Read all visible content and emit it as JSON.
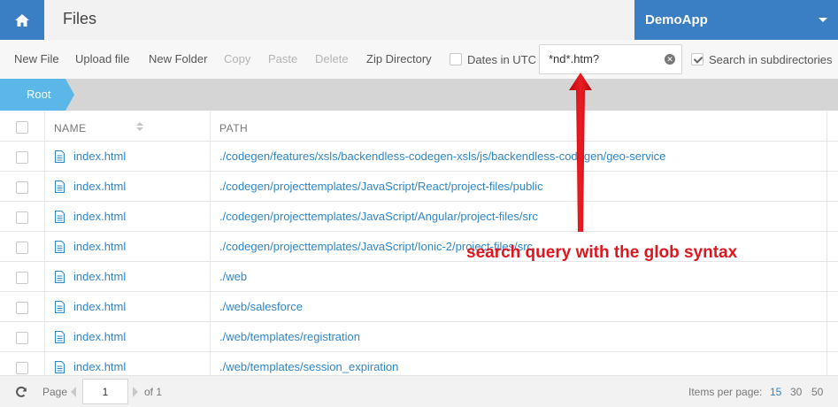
{
  "header": {
    "title": "Files",
    "app_name": "DemoApp"
  },
  "toolbar": {
    "new_file": "New File",
    "upload_file": "Upload file",
    "new_folder": "New Folder",
    "copy": "Copy",
    "paste": "Paste",
    "delete": "Delete",
    "zip_directory": "Zip Directory",
    "dates_utc_label": "Dates in UTC",
    "dates_utc_checked": false,
    "search_value": "*nd*.htm?",
    "search_subdirs_label": "Search in subdirectories",
    "search_subdirs_checked": true
  },
  "breadcrumb": {
    "root": "Root"
  },
  "table": {
    "columns": {
      "name": "NAME",
      "path": "PATH"
    },
    "rows": [
      {
        "name": "index.html",
        "path": "./codegen/features/xsls/backendless-codegen-xsls/js/backendless-codegen/geo-service"
      },
      {
        "name": "index.html",
        "path": "./codegen/projecttemplates/JavaScript/React/project-files/public"
      },
      {
        "name": "index.html",
        "path": "./codegen/projecttemplates/JavaScript/Angular/project-files/src"
      },
      {
        "name": "index.html",
        "path": "./codegen/projecttemplates/JavaScript/Ionic-2/project-files/src"
      },
      {
        "name": "index.html",
        "path": "./web"
      },
      {
        "name": "index.html",
        "path": "./web/salesforce"
      },
      {
        "name": "index.html",
        "path": "./web/templates/registration"
      },
      {
        "name": "index.html",
        "path": "./web/templates/session_expiration"
      }
    ]
  },
  "footer": {
    "page_label": "Page",
    "page_value": "1",
    "of_label": "of 1",
    "items_per_page_label": "Items per page:",
    "items_per_page_options": [
      "15",
      "30",
      "50"
    ],
    "items_per_page_selected": "15"
  },
  "annotation": {
    "text": "search query with the glob syntax",
    "color": "#e0161e"
  },
  "colors": {
    "brand_blue": "#3a7ec4",
    "breadcrumb_blue": "#5bb7e8",
    "link_blue": "#2f86c9"
  }
}
